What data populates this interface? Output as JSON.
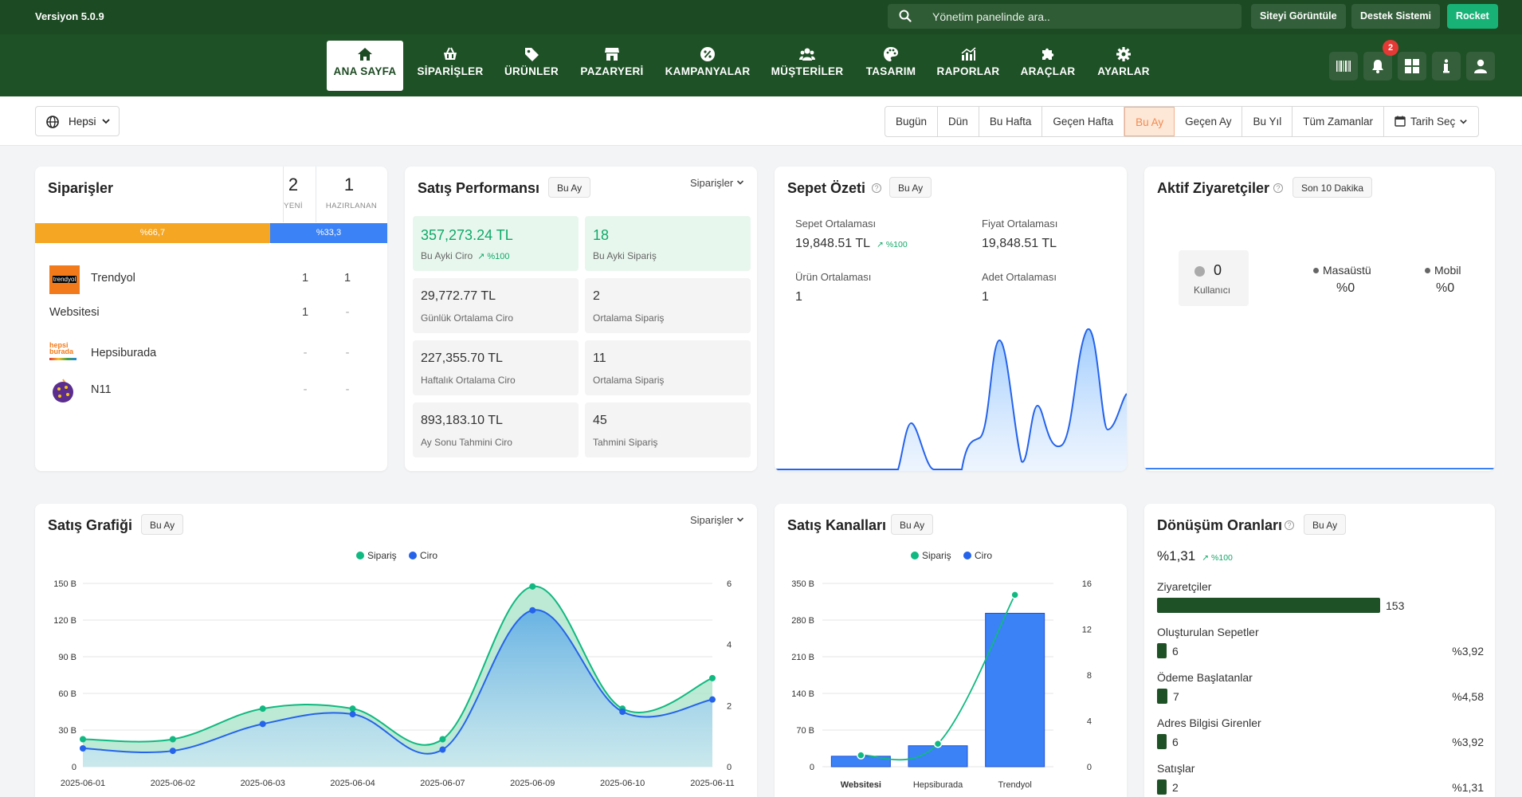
{
  "top": {
    "version": "Versiyon 5.0.9",
    "search_placeholder": "Yönetim panelinde ara..",
    "buttons": [
      "Siteyi Görüntüle",
      "Destek Sistemi",
      "Rocket"
    ]
  },
  "nav": {
    "items": [
      {
        "label": "ANA SAYFA",
        "icon": "home-icon",
        "active": true
      },
      {
        "label": "SİPARİŞLER",
        "icon": "basket-icon"
      },
      {
        "label": "ÜRÜNLER",
        "icon": "tag-icon"
      },
      {
        "label": "PAZARYERİ",
        "icon": "store-icon"
      },
      {
        "label": "KAMPANYALAR",
        "icon": "percent-icon"
      },
      {
        "label": "MÜŞTERİLER",
        "icon": "users-icon"
      },
      {
        "label": "TASARIM",
        "icon": "palette-icon"
      },
      {
        "label": "RAPORLAR",
        "icon": "chart-icon"
      },
      {
        "label": "ARAÇLAR",
        "icon": "puzzle-icon"
      },
      {
        "label": "AYARLAR",
        "icon": "gear-icon"
      }
    ],
    "notification_count": "2"
  },
  "filters": {
    "scope": "Hepsi",
    "ranges": [
      "Bugün",
      "Dün",
      "Bu Hafta",
      "Geçen Hafta",
      "Bu Ay",
      "Geçen Ay",
      "Bu Yıl",
      "Tüm Zamanlar",
      "Tarih Seç"
    ],
    "active_range": "Bu Ay"
  },
  "orders": {
    "title": "Siparişler",
    "new_count": "2",
    "new_label": "YENİ",
    "prep_count": "1",
    "prep_label": "HAZIRLANAN",
    "bar_left_label": "%66,7",
    "bar_left_pct": 66.7,
    "bar_right_label": "%33,3",
    "channels": [
      {
        "name": "Trendyol",
        "v1": "1",
        "v2": "1",
        "logo_text": "trendyol"
      },
      {
        "name": "Websitesi",
        "v1": "1",
        "v2": "-"
      },
      {
        "name": "Hepsiburada",
        "v1": "-",
        "v2": "-",
        "logo_text": "hepsi burada"
      },
      {
        "name": "N11",
        "v1": "-",
        "v2": "-"
      }
    ]
  },
  "sales_perf": {
    "title": "Satış Performansı",
    "badge": "Bu Ay",
    "dropdown": "Siparişler",
    "tiles": [
      {
        "value": "357,273.24 TL",
        "label": "Bu Ayki Ciro",
        "change": "%100"
      },
      {
        "value": "18",
        "label": "Bu Ayki Sipariş"
      },
      {
        "value": "29,772.77 TL",
        "label": "Günlük Ortalama Ciro"
      },
      {
        "value": "2",
        "label": "Ortalama Sipariş"
      },
      {
        "value": "227,355.70 TL",
        "label": "Haftalık Ortalama Ciro"
      },
      {
        "value": "11",
        "label": "Ortalama Sipariş"
      },
      {
        "value": "893,183.10 TL",
        "label": "Ay Sonu Tahmini Ciro"
      },
      {
        "value": "45",
        "label": "Tahmini Sipariş"
      }
    ]
  },
  "basket": {
    "title": "Sepet Özeti",
    "badge": "Bu Ay",
    "stats": [
      {
        "label": "Sepet Ortalaması",
        "value": "19,848.51 TL",
        "change": "%100"
      },
      {
        "label": "Fiyat Ortalaması",
        "value": "19,848.51 TL"
      },
      {
        "label": "Ürün Ortalaması",
        "value": "1"
      },
      {
        "label": "Adet Ortalaması",
        "value": "1"
      }
    ]
  },
  "visitors": {
    "title": "Aktif Ziyaretçiler",
    "badge": "Son 10 Dakika",
    "users": "0",
    "users_label": "Kullanıcı",
    "desktop_label": "Masaüstü",
    "desktop_value": "%0",
    "mobile_label": "Mobil",
    "mobile_value": "%0"
  },
  "sales_graph": {
    "title": "Satış Grafiği",
    "badge": "Bu Ay",
    "dropdown": "Siparişler"
  },
  "sales_channels": {
    "title": "Satış Kanalları",
    "badge": "Bu Ay"
  },
  "conversion": {
    "title": "Dönüşüm Oranları",
    "badge": "Bu Ay",
    "rate": "%1,31",
    "change": "%100",
    "rows": [
      {
        "label": "Ziyaretçiler",
        "value": "153",
        "pct": "",
        "frac": 1.0
      },
      {
        "label": "Oluşturulan Sepetler",
        "value": "6",
        "pct": "%3,92",
        "frac": 0.0392
      },
      {
        "label": "Ödeme Başlatanlar",
        "value": "7",
        "pct": "%4,58",
        "frac": 0.0458
      },
      {
        "label": "Adres Bilgisi Girenler",
        "value": "6",
        "pct": "%3,92",
        "frac": 0.0392
      },
      {
        "label": "Satışlar",
        "value": "2",
        "pct": "%1,31",
        "frac": 0.0131
      }
    ]
  },
  "colors": {
    "brand": "#1c4a22",
    "accent": "#18b277",
    "orange": "#f5a623",
    "blue": "#3b82f6"
  },
  "chart_data": [
    {
      "type": "line",
      "x": [
        "2025-06-01",
        "2025-06-02",
        "2025-06-03",
        "2025-06-04",
        "2025-06-07",
        "2025-06-09",
        "2025-06-10",
        "2025-06-11"
      ],
      "series": [
        {
          "name": "Sipariş",
          "axis": "right",
          "values": [
            0.9,
            0.9,
            1.9,
            1.9,
            0.9,
            5.9,
            1.9,
            2.9
          ]
        },
        {
          "name": "Ciro",
          "axis": "left",
          "values": [
            15,
            13,
            35,
            43,
            14,
            128,
            45,
            55
          ]
        }
      ],
      "ylim_left": [
        0,
        150
      ],
      "yticks_left": [
        "0",
        "30 B",
        "60 B",
        "90 B",
        "120 B",
        "150 B"
      ],
      "ylim_right": [
        0,
        6
      ],
      "yticks_right": [
        "0",
        "2",
        "4",
        "6"
      ]
    },
    {
      "type": "bar",
      "categories": [
        "Websitesi",
        "Hepsiburada",
        "Trendyol"
      ],
      "series": [
        {
          "name": "Ciro",
          "axis": "left",
          "values": [
            20,
            40,
            293
          ]
        },
        {
          "name": "Sipariş",
          "axis": "right",
          "values": [
            1,
            2,
            15
          ]
        }
      ],
      "ylim_left": [
        0,
        350
      ],
      "yticks_left": [
        "0",
        "70 B",
        "140 B",
        "210 B",
        "280 B",
        "350 B"
      ],
      "ylim_right": [
        0,
        16
      ],
      "yticks_right": [
        "0",
        "4",
        "8",
        "12",
        "16"
      ]
    }
  ]
}
